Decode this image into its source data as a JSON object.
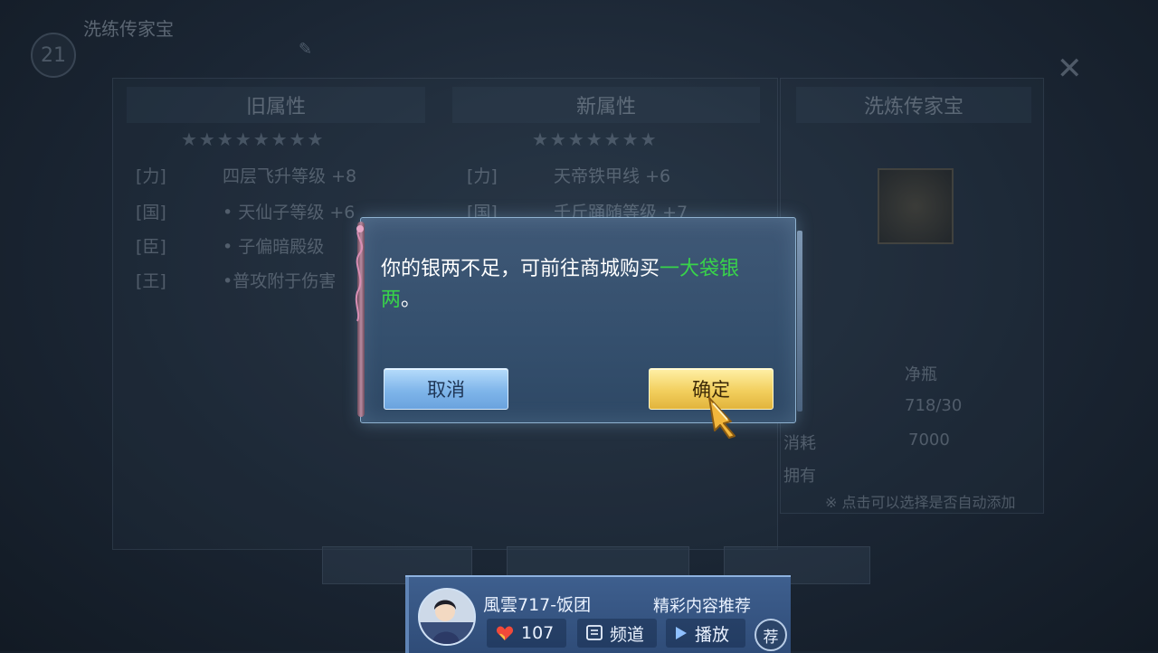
{
  "background": {
    "level": "21",
    "title": "洗练传家宝",
    "tab_old": "旧属性",
    "tab_new": "新属性",
    "tab_heirloom": "洗炼传家宝",
    "old_stars": "★★★★★★★★",
    "new_stars": "★★★★★★★",
    "old_attrs": [
      {
        "slot": "[力]",
        "text": "四层飞升等级 +8"
      },
      {
        "slot": "[国]",
        "text": "• 天仙子等级 +6"
      },
      {
        "slot": "[臣]",
        "text": "• 子偏暗殿级"
      },
      {
        "slot": "[王]",
        "text": "•普攻附于伤害"
      }
    ],
    "new_attrs": [
      {
        "slot": "[力]",
        "text": "天帝铁甲线 +6"
      },
      {
        "slot": "[国]",
        "text": "千斤踊随等级 +7"
      }
    ],
    "item_name": "净瓶",
    "item_count": "718/30",
    "cost_label": "消耗",
    "cost_value": "7000",
    "own_label": "拥有",
    "hint": "※ 点击可以选择是否自动添加"
  },
  "dialog": {
    "message_part1": "你的银两不足，可前往商城购买",
    "message_highlight": "一大袋银两",
    "message_part2": "。",
    "cancel_label": "取消",
    "confirm_label": "确定",
    "highlight_color": "#38d34a"
  },
  "widget": {
    "streamer_name": "風雲717-饭团",
    "recommend_label": "精彩内容推荐",
    "likes": "107",
    "channel_label": "频道",
    "play_label": "播放",
    "rec_label": "荐"
  }
}
